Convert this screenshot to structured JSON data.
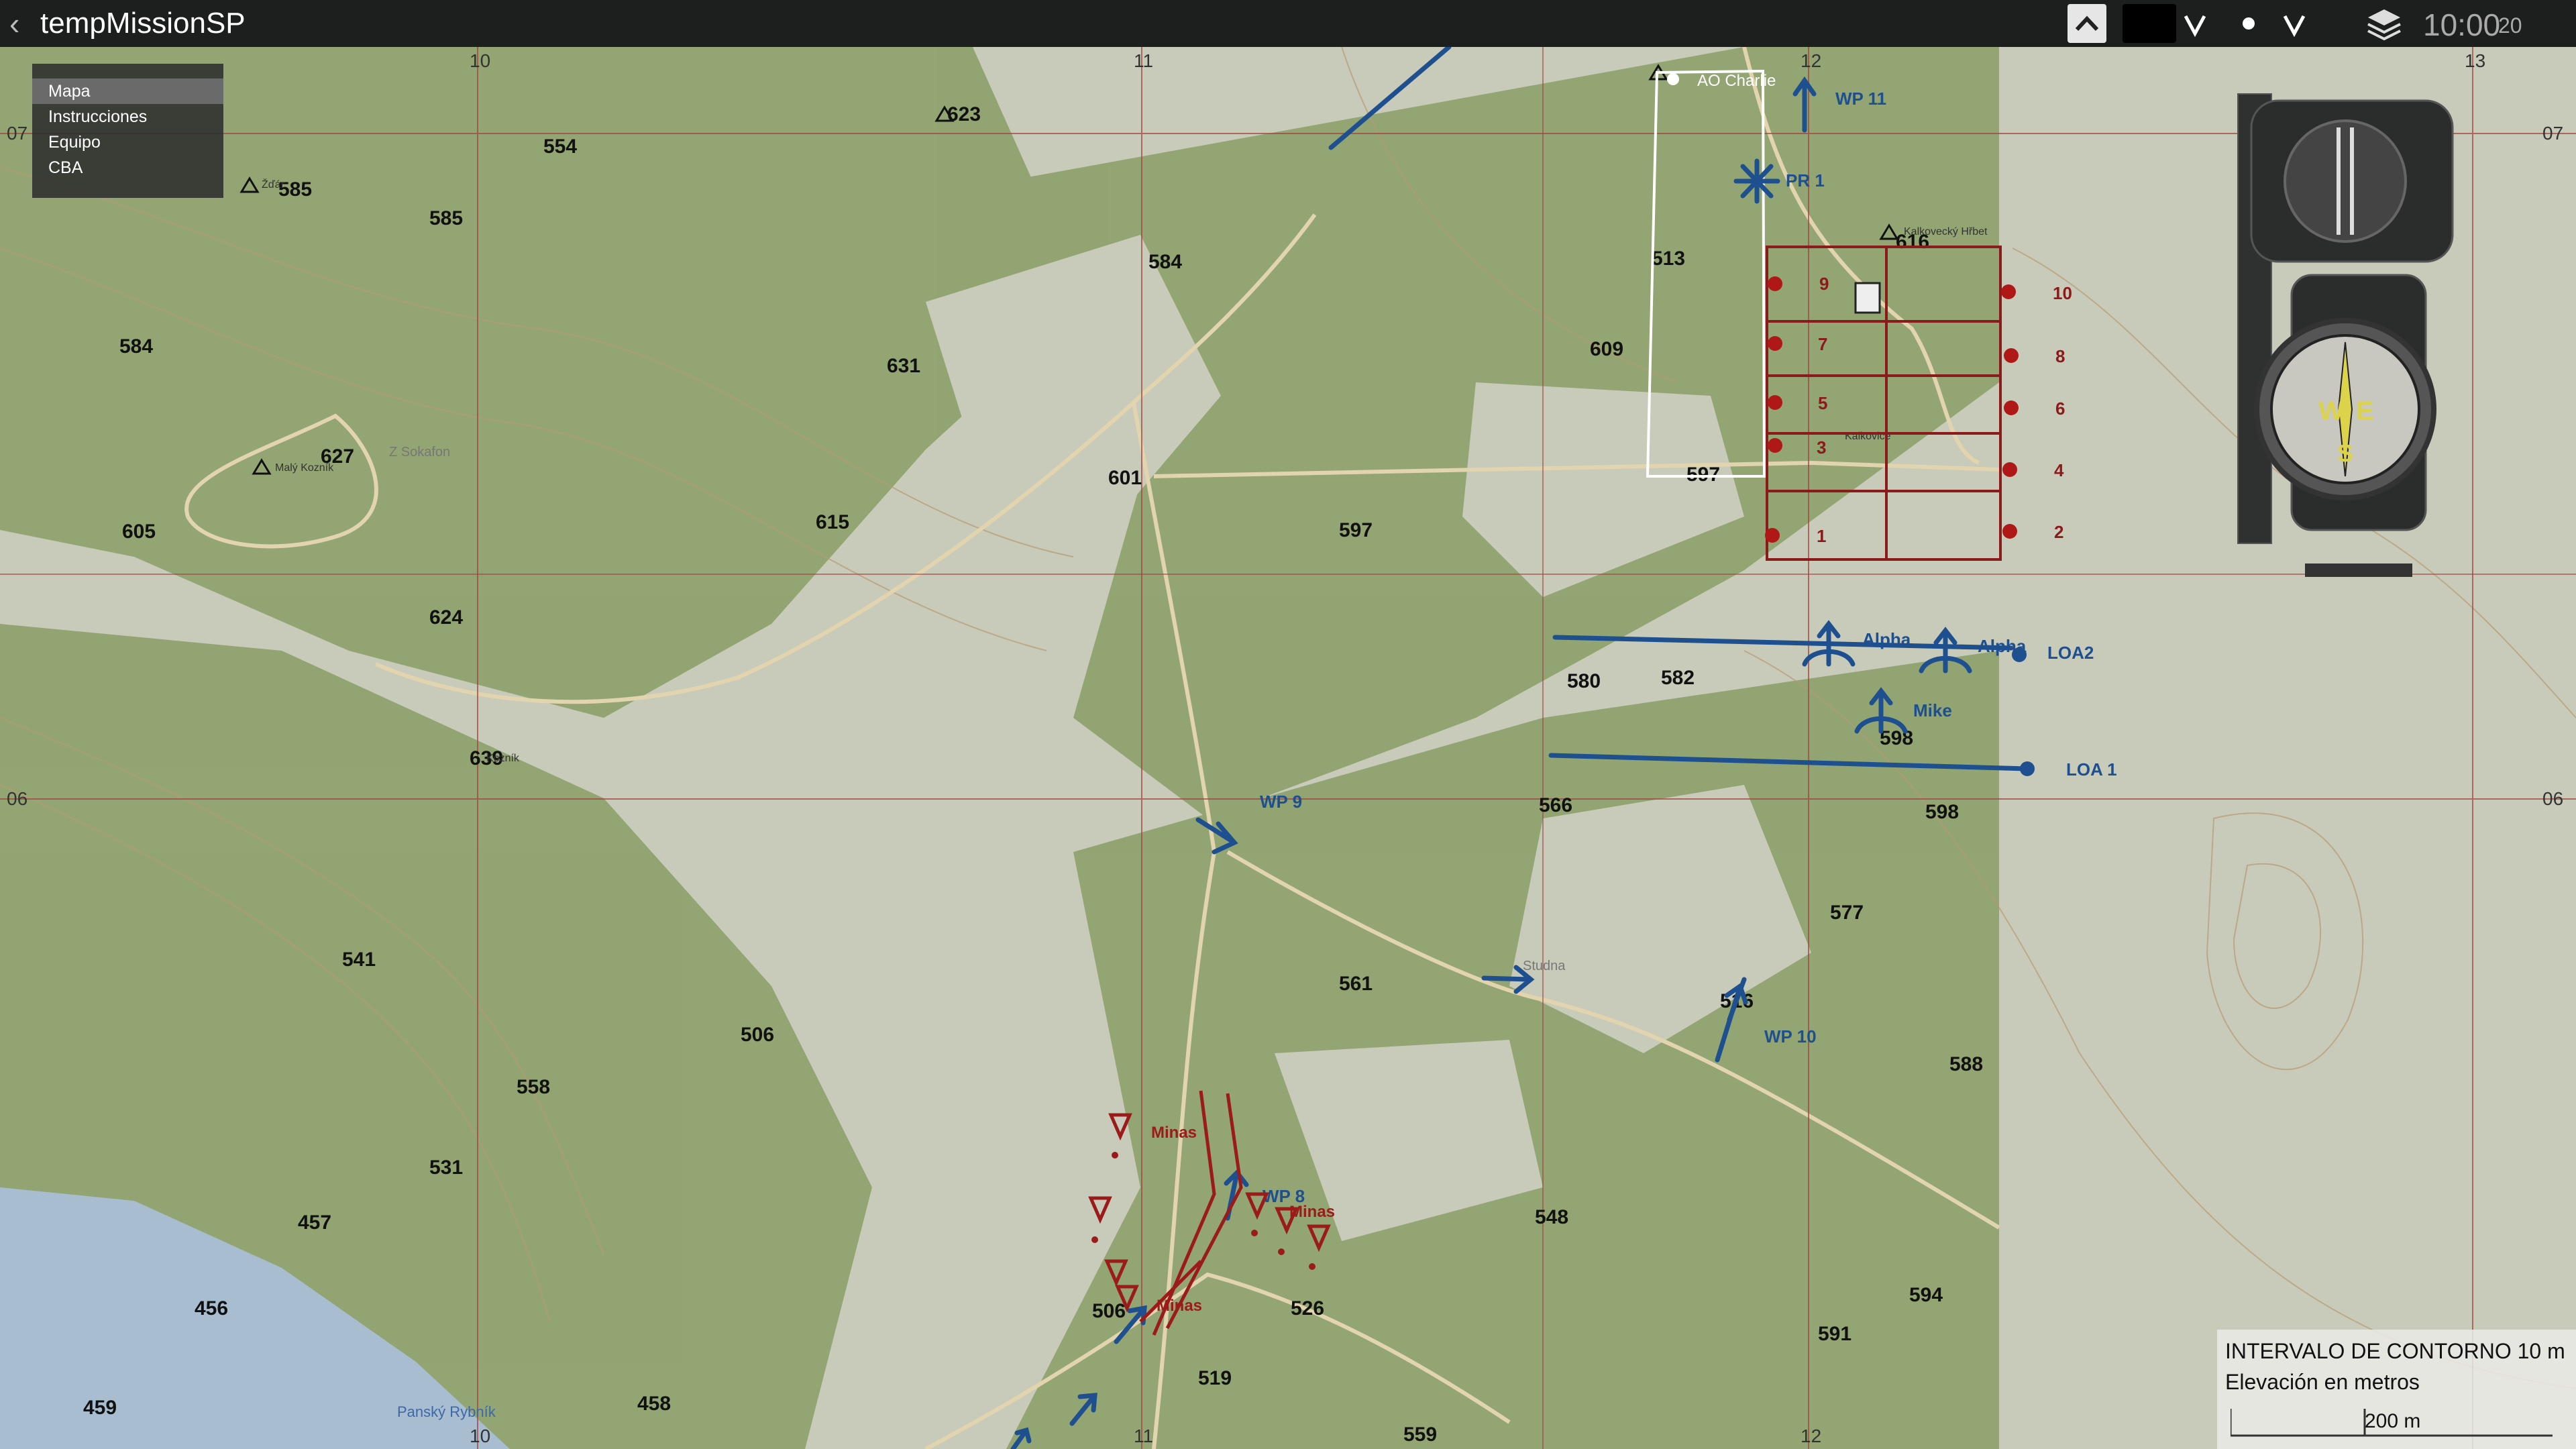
{
  "window": {
    "title": "tempMissionSP",
    "back_icon": "‹"
  },
  "toolbar": {
    "time_main": "10:00",
    "time_seconds": "20",
    "chev_up": "^",
    "chev_v": "V"
  },
  "menu": {
    "items": [
      "Mapa",
      "Instrucciones",
      "Equipo",
      "CBA"
    ]
  },
  "map": {
    "grid_top": [
      "10",
      "11",
      "12",
      "13"
    ],
    "grid_bottom": [
      "10",
      "11",
      "12"
    ],
    "grid_left": [
      "07",
      "06"
    ],
    "grid_right": [
      "07",
      "06"
    ],
    "elevations": [
      "554",
      "623",
      "585",
      "585",
      "584",
      "584",
      "631",
      "627",
      "605",
      "615",
      "601",
      "597",
      "624",
      "639",
      "609",
      "513",
      "616",
      "597",
      "580",
      "582",
      "598",
      "566",
      "598",
      "577",
      "541",
      "506",
      "561",
      "516",
      "558",
      "531",
      "457",
      "456",
      "459",
      "458",
      "506",
      "526",
      "519",
      "548",
      "588",
      "591",
      "594",
      "559"
    ],
    "places": [
      "AO Charlie",
      "Kozník",
      "Malý Kozník",
      "Z Sokafon",
      "Kalkovice",
      "Kalkovecký Hřbet",
      "Studna",
      "Panský Rybník",
      "Žďár"
    ],
    "markers": [
      "WP 11",
      "PR 1",
      "Alpha",
      "Alpha",
      "LOA2",
      "Mike",
      "LOA 1",
      "WP 9",
      "WP 10",
      "WP 8"
    ],
    "mines": [
      "Minas",
      "Minas",
      "Minas"
    ],
    "grid_numbers": [
      "9",
      "7",
      "5",
      "3",
      "1",
      "10",
      "8",
      "6",
      "4",
      "2"
    ]
  },
  "legend": {
    "contour_interval": "INTERVALO DE CONTORNO 10 m",
    "elevation_units": "Elevación en metros",
    "scale": "200 m"
  },
  "colors": {
    "forest": "#8fa26f",
    "field": "#c9ccba",
    "marker_blue": "#1e4f8f",
    "marker_red": "#9b1b1b",
    "water": "#a9bdd0"
  }
}
